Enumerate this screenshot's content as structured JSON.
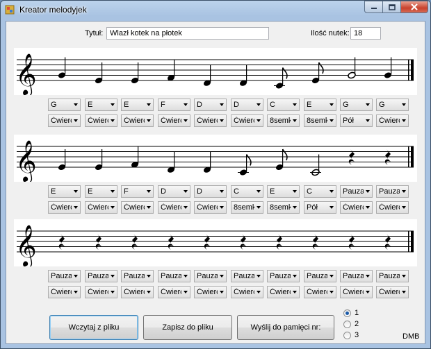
{
  "window": {
    "title": "Kreator melodyjek"
  },
  "form": {
    "title_label": "Tytuł:",
    "title_value": "Wlazł kotek na płotek",
    "count_label": "Ilość nutek:",
    "count_value": "18"
  },
  "staves": [
    {
      "notes": [
        {
          "pitch": "G",
          "duration": "quarter"
        },
        {
          "pitch": "E",
          "duration": "quarter"
        },
        {
          "pitch": "E",
          "duration": "quarter"
        },
        {
          "pitch": "F",
          "duration": "quarter"
        },
        {
          "pitch": "D",
          "duration": "quarter"
        },
        {
          "pitch": "D",
          "duration": "quarter"
        },
        {
          "pitch": "C",
          "duration": "eighth"
        },
        {
          "pitch": "E",
          "duration": "eighth"
        },
        {
          "pitch": "G",
          "duration": "half"
        },
        {
          "pitch": "G",
          "duration": "quarter"
        }
      ]
    },
    {
      "notes": [
        {
          "pitch": "E",
          "duration": "quarter"
        },
        {
          "pitch": "E",
          "duration": "quarter"
        },
        {
          "pitch": "F",
          "duration": "quarter"
        },
        {
          "pitch": "D",
          "duration": "quarter"
        },
        {
          "pitch": "D",
          "duration": "quarter"
        },
        {
          "pitch": "C",
          "duration": "eighth"
        },
        {
          "pitch": "E",
          "duration": "eighth"
        },
        {
          "pitch": "C",
          "duration": "half"
        },
        {
          "pitch": "rest",
          "duration": "quarter"
        },
        {
          "pitch": "rest",
          "duration": "quarter"
        }
      ]
    },
    {
      "notes": [
        {
          "pitch": "rest",
          "duration": "quarter"
        },
        {
          "pitch": "rest",
          "duration": "quarter"
        },
        {
          "pitch": "rest",
          "duration": "quarter"
        },
        {
          "pitch": "rest",
          "duration": "quarter"
        },
        {
          "pitch": "rest",
          "duration": "quarter"
        },
        {
          "pitch": "rest",
          "duration": "quarter"
        },
        {
          "pitch": "rest",
          "duration": "quarter"
        },
        {
          "pitch": "rest",
          "duration": "quarter"
        },
        {
          "pitch": "rest",
          "duration": "quarter"
        },
        {
          "pitch": "rest",
          "duration": "quarter"
        }
      ]
    }
  ],
  "rows": [
    {
      "pitches": [
        "G",
        "E",
        "E",
        "F",
        "D",
        "D",
        "C",
        "E",
        "G",
        "G"
      ],
      "durations": [
        "Ćwierć",
        "Ćwierć",
        "Ćwierć",
        "Ćwierć",
        "Ćwierć",
        "Ćwierć",
        "8semk",
        "8semk",
        "Pół",
        "Ćwierć"
      ]
    },
    {
      "pitches": [
        "E",
        "E",
        "F",
        "D",
        "D",
        "C",
        "E",
        "C",
        "Pauza",
        "Pauza"
      ],
      "durations": [
        "Ćwierć",
        "Ćwierć",
        "Ćwierć",
        "Ćwierć",
        "Ćwierć",
        "8semk",
        "8semk",
        "Pół",
        "Ćwierć",
        "Ćwierć"
      ]
    },
    {
      "pitches": [
        "Pauza",
        "Pauza",
        "Pauza",
        "Pauza",
        "Pauza",
        "Pauza",
        "Pauza",
        "Pauza",
        "Pauza",
        "Pauza"
      ],
      "durations": [
        "Ćwierć",
        "Ćwierć",
        "Ćwierć",
        "Ćwierć",
        "Ćwierć",
        "Ćwierć",
        "Ćwierć",
        "Ćwierć",
        "Ćwierć",
        "Ćwierć"
      ]
    }
  ],
  "buttons": {
    "load": "Wczytaj z pliku",
    "save": "Zapisz do pliku",
    "send": "Wyślij do pamięci nr:"
  },
  "memory": {
    "options": [
      "1",
      "2",
      "3"
    ],
    "selected": "1"
  },
  "credit": "DMB"
}
